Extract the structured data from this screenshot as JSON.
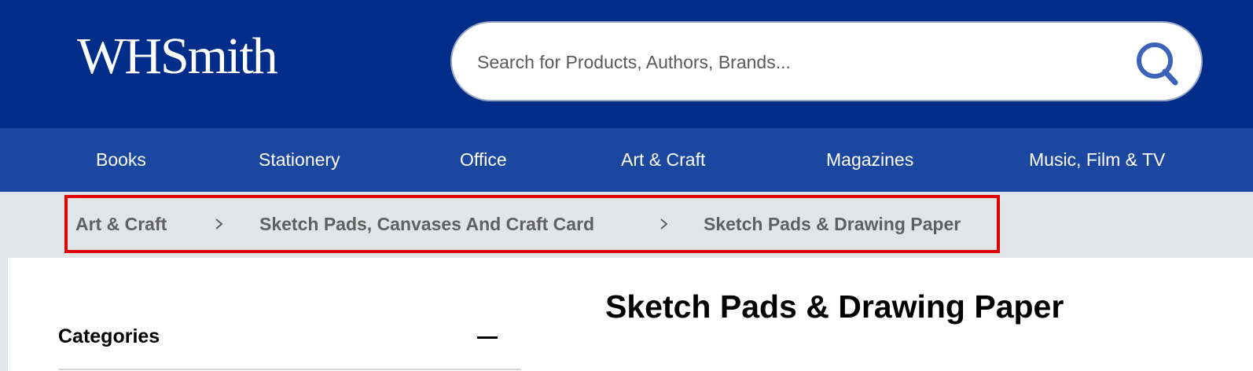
{
  "header": {
    "logo_text": "WHSmith",
    "search": {
      "placeholder": "Search for Products, Authors, Brands..."
    }
  },
  "nav": {
    "items": [
      {
        "label": "Books"
      },
      {
        "label": "Stationery"
      },
      {
        "label": "Office"
      },
      {
        "label": "Art & Craft"
      },
      {
        "label": "Magazines"
      },
      {
        "label": "Music, Film & TV"
      }
    ]
  },
  "breadcrumb": {
    "items": [
      {
        "label": "Art & Craft"
      },
      {
        "label": "Sketch Pads, Canvases And Craft Card"
      },
      {
        "label": "Sketch Pads & Drawing Paper"
      }
    ],
    "separator_icon": "chevron-right-icon"
  },
  "sidebar": {
    "categories_heading": "Categories",
    "toggle_icon": "minus-icon"
  },
  "main": {
    "page_title": "Sketch Pads & Drawing Paper"
  },
  "colors": {
    "header_bg": "#002d8a",
    "nav_bg": "#1c47a0",
    "breadcrumb_bg": "#e2e5e8",
    "highlight_border": "#e00000",
    "search_icon": "#3d63b8"
  }
}
